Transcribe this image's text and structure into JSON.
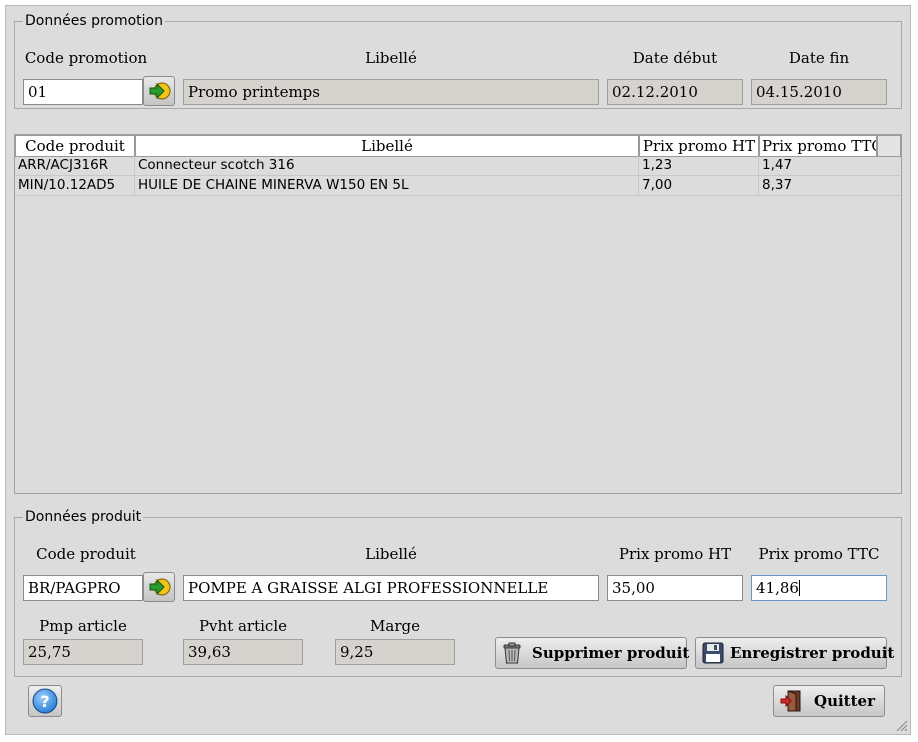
{
  "promo": {
    "legend": "Données promotion",
    "code_label": "Code promotion",
    "libelle_label": "Libellé",
    "date_debut_label": "Date début",
    "date_fin_label": "Date fin",
    "code_value": "01",
    "libelle_value": "Promo printemps",
    "date_debut_value": "02.12.2010",
    "date_fin_value": "04.15.2010"
  },
  "table": {
    "columns": [
      "Code produit",
      "Libellé",
      "Prix promo HT",
      "Prix promo TTC"
    ],
    "rows": [
      [
        "ARR/ACJ316R",
        "Connecteur scotch 316",
        "1,23",
        "1,47"
      ],
      [
        "MIN/10.12AD5",
        "HUILE DE CHAINE MINERVA W150 EN 5L",
        "7,00",
        "8,37"
      ]
    ]
  },
  "product": {
    "legend": "Données produit",
    "code_label": "Code produit",
    "libelle_label": "Libellé",
    "prix_ht_label": "Prix promo HT",
    "prix_ttc_label": "Prix promo TTC",
    "code_value": "BR/PAGPRO",
    "libelle_value": "POMPE A GRAISSE ALGI PROFESSIONNELLE",
    "prix_ht_value": "35,00",
    "prix_ttc_value": "41,86",
    "pmp_label": "Pmp article",
    "pvht_label": "Pvht article",
    "marge_label": "Marge",
    "pmp_value": "25,75",
    "pvht_value": "39,63",
    "marge_value": "9,25",
    "delete_label": "Supprimer produit",
    "save_label": "Enregistrer produit"
  },
  "footer": {
    "quit_label": "Quitter"
  },
  "icons": {
    "lookup": "arrow-go-icon",
    "help": "help-icon",
    "trash": "trash-icon",
    "save": "floppy-disk-icon",
    "quit": "exit-door-icon"
  },
  "colors": {
    "window_bg": "#dcdcdc",
    "readonly_bg": "#d6d3ce",
    "focus_border": "#6b94c9",
    "help_blue": "#2a7fd4",
    "arrow_green": "#2e9b2e",
    "arrow_yellow": "#f0c419"
  }
}
